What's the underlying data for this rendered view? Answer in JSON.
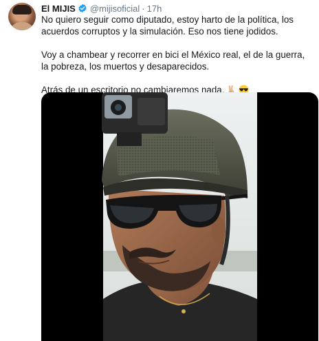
{
  "tweet": {
    "author_name": "El MIJIS",
    "handle": "@mijisoficial",
    "separator": "·",
    "time": "17h",
    "paragraphs": [
      "No quiero seguir como diputado, estoy harto de la política, los acuerdos corruptos y la simulación. Eso nos tiene jodidos.",
      "Voy a chambear y recorrer en bici el México real, el de la guerra, la pobreza, los muertos y desaparecidos.",
      "Atrás de un escritorio no cambiaremos nada."
    ],
    "emojis": [
      "victory-hand-emoji",
      "sunglasses-face-emoji"
    ]
  },
  "colors": {
    "verified_badge": "#1da1f2",
    "handle_gray": "#657786",
    "media_background": "#000000",
    "sky": "#f2f4f4"
  },
  "icons": [
    "verified-badge-icon"
  ]
}
